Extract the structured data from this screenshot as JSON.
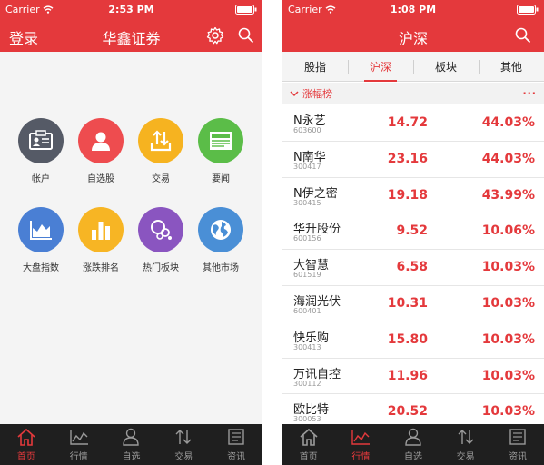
{
  "left": {
    "status": {
      "carrier": "Carrier",
      "time": "2:53 PM"
    },
    "nav": {
      "login": "登录",
      "title": "华鑫证券"
    },
    "grid": [
      {
        "label": "帐户",
        "icon": "id-card-icon",
        "color": "#555a66"
      },
      {
        "label": "自选股",
        "icon": "person-icon",
        "color": "#ee4c4f"
      },
      {
        "label": "交易",
        "icon": "transfer-arrows-icon",
        "color": "#f6b320"
      },
      {
        "label": "要闻",
        "icon": "news-icon",
        "color": "#5bbd48"
      },
      {
        "label": "大盘指数",
        "icon": "area-chart-icon",
        "color": "#4a7fd4"
      },
      {
        "label": "涨跌排名",
        "icon": "bar-chart-icon",
        "color": "#f7b524"
      },
      {
        "label": "热门板块",
        "icon": "people-group-icon",
        "color": "#8a55c0"
      },
      {
        "label": "其他市场",
        "icon": "globe-icon",
        "color": "#4a8fd6"
      }
    ],
    "tabs": [
      {
        "label": "首页",
        "icon": "home-icon",
        "active": true
      },
      {
        "label": "行情",
        "icon": "line-chart-icon",
        "active": false
      },
      {
        "label": "自选",
        "icon": "user-icon",
        "active": false
      },
      {
        "label": "交易",
        "icon": "updown-arrows-icon",
        "active": false
      },
      {
        "label": "资讯",
        "icon": "document-icon",
        "active": false
      }
    ]
  },
  "right": {
    "status": {
      "carrier": "Carrier",
      "time": "1:08 PM"
    },
    "nav": {
      "title": "沪深"
    },
    "segments": [
      {
        "label": "股指",
        "active": false
      },
      {
        "label": "沪深",
        "active": true
      },
      {
        "label": "板块",
        "active": false
      },
      {
        "label": "其他",
        "active": false
      }
    ],
    "section": {
      "title": "涨幅榜",
      "more": "···"
    },
    "stocks": [
      {
        "name": "N永艺",
        "code": "603600",
        "price": "14.72",
        "change": "44.03%"
      },
      {
        "name": "N南华",
        "code": "300417",
        "price": "23.16",
        "change": "44.03%"
      },
      {
        "name": "N伊之密",
        "code": "300415",
        "price": "19.18",
        "change": "43.99%"
      },
      {
        "name": "华升股份",
        "code": "600156",
        "price": "9.52",
        "change": "10.06%"
      },
      {
        "name": "大智慧",
        "code": "601519",
        "price": "6.58",
        "change": "10.03%"
      },
      {
        "name": "海润光伏",
        "code": "600401",
        "price": "10.31",
        "change": "10.03%"
      },
      {
        "name": "快乐购",
        "code": "300413",
        "price": "15.80",
        "change": "10.03%"
      },
      {
        "name": "万讯自控",
        "code": "300112",
        "price": "11.96",
        "change": "10.03%"
      },
      {
        "name": "欧比特",
        "code": "300053",
        "price": "20.52",
        "change": "10.03%"
      }
    ],
    "tabs": [
      {
        "label": "首页",
        "icon": "home-icon",
        "active": false
      },
      {
        "label": "行情",
        "icon": "line-chart-icon",
        "active": true
      },
      {
        "label": "自选",
        "icon": "user-icon",
        "active": false
      },
      {
        "label": "交易",
        "icon": "updown-arrows-icon",
        "active": false
      },
      {
        "label": "资讯",
        "icon": "document-icon",
        "active": false
      }
    ]
  }
}
